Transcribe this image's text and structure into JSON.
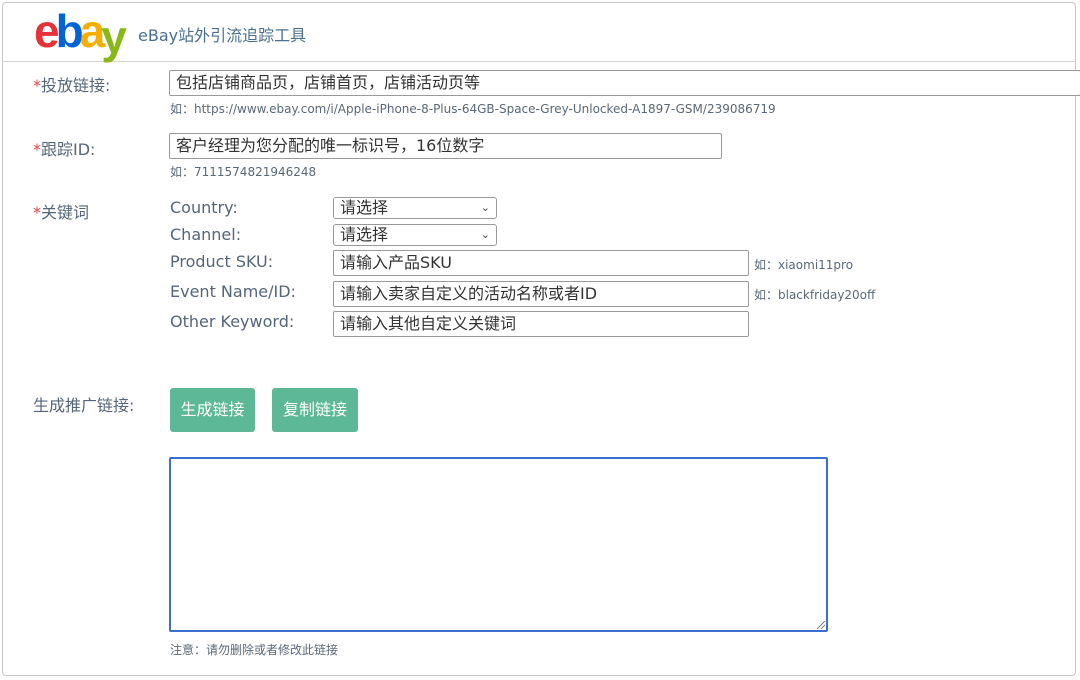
{
  "header": {
    "logo_e": "e",
    "logo_b": "b",
    "logo_a": "a",
    "logo_y": "y",
    "title": "eBay站外引流追踪工具"
  },
  "form": {
    "required_mark": "*",
    "link": {
      "label": "投放链接:",
      "placeholder": "包括店铺商品页，店铺首页，店铺活动页等",
      "hint": "如：https://www.ebay.com/i/Apple-iPhone-8-Plus-64GB-Space-Grey-Unlocked-A1897-GSM/239086719"
    },
    "tracking": {
      "label": "跟踪ID:",
      "placeholder": "客户经理为您分配的唯一标识号，16位数字",
      "hint": "如：7111574821946248"
    },
    "keywords": {
      "label": "关键词",
      "country_label": "Country:",
      "country_value": "请选择",
      "channel_label": "Channel:",
      "channel_value": "请选择",
      "sku_label": "Product SKU:",
      "sku_placeholder": "请输入产品SKU",
      "sku_hint": "如：xiaomi11pro",
      "event_label": "Event Name/ID:",
      "event_placeholder": "请输入卖家自定义的活动名称或者ID",
      "event_hint": "如：blackfriday20off",
      "other_label": "Other Keyword:",
      "other_placeholder": "请输入其他自定义关键词"
    },
    "generate": {
      "label": "生成推广链接:",
      "generate_button": "生成链接",
      "copy_button": "复制链接",
      "note": "注意：请勿删除或者修改此链接"
    }
  },
  "icons": {
    "select_chevron": "chevron-down-icon"
  }
}
